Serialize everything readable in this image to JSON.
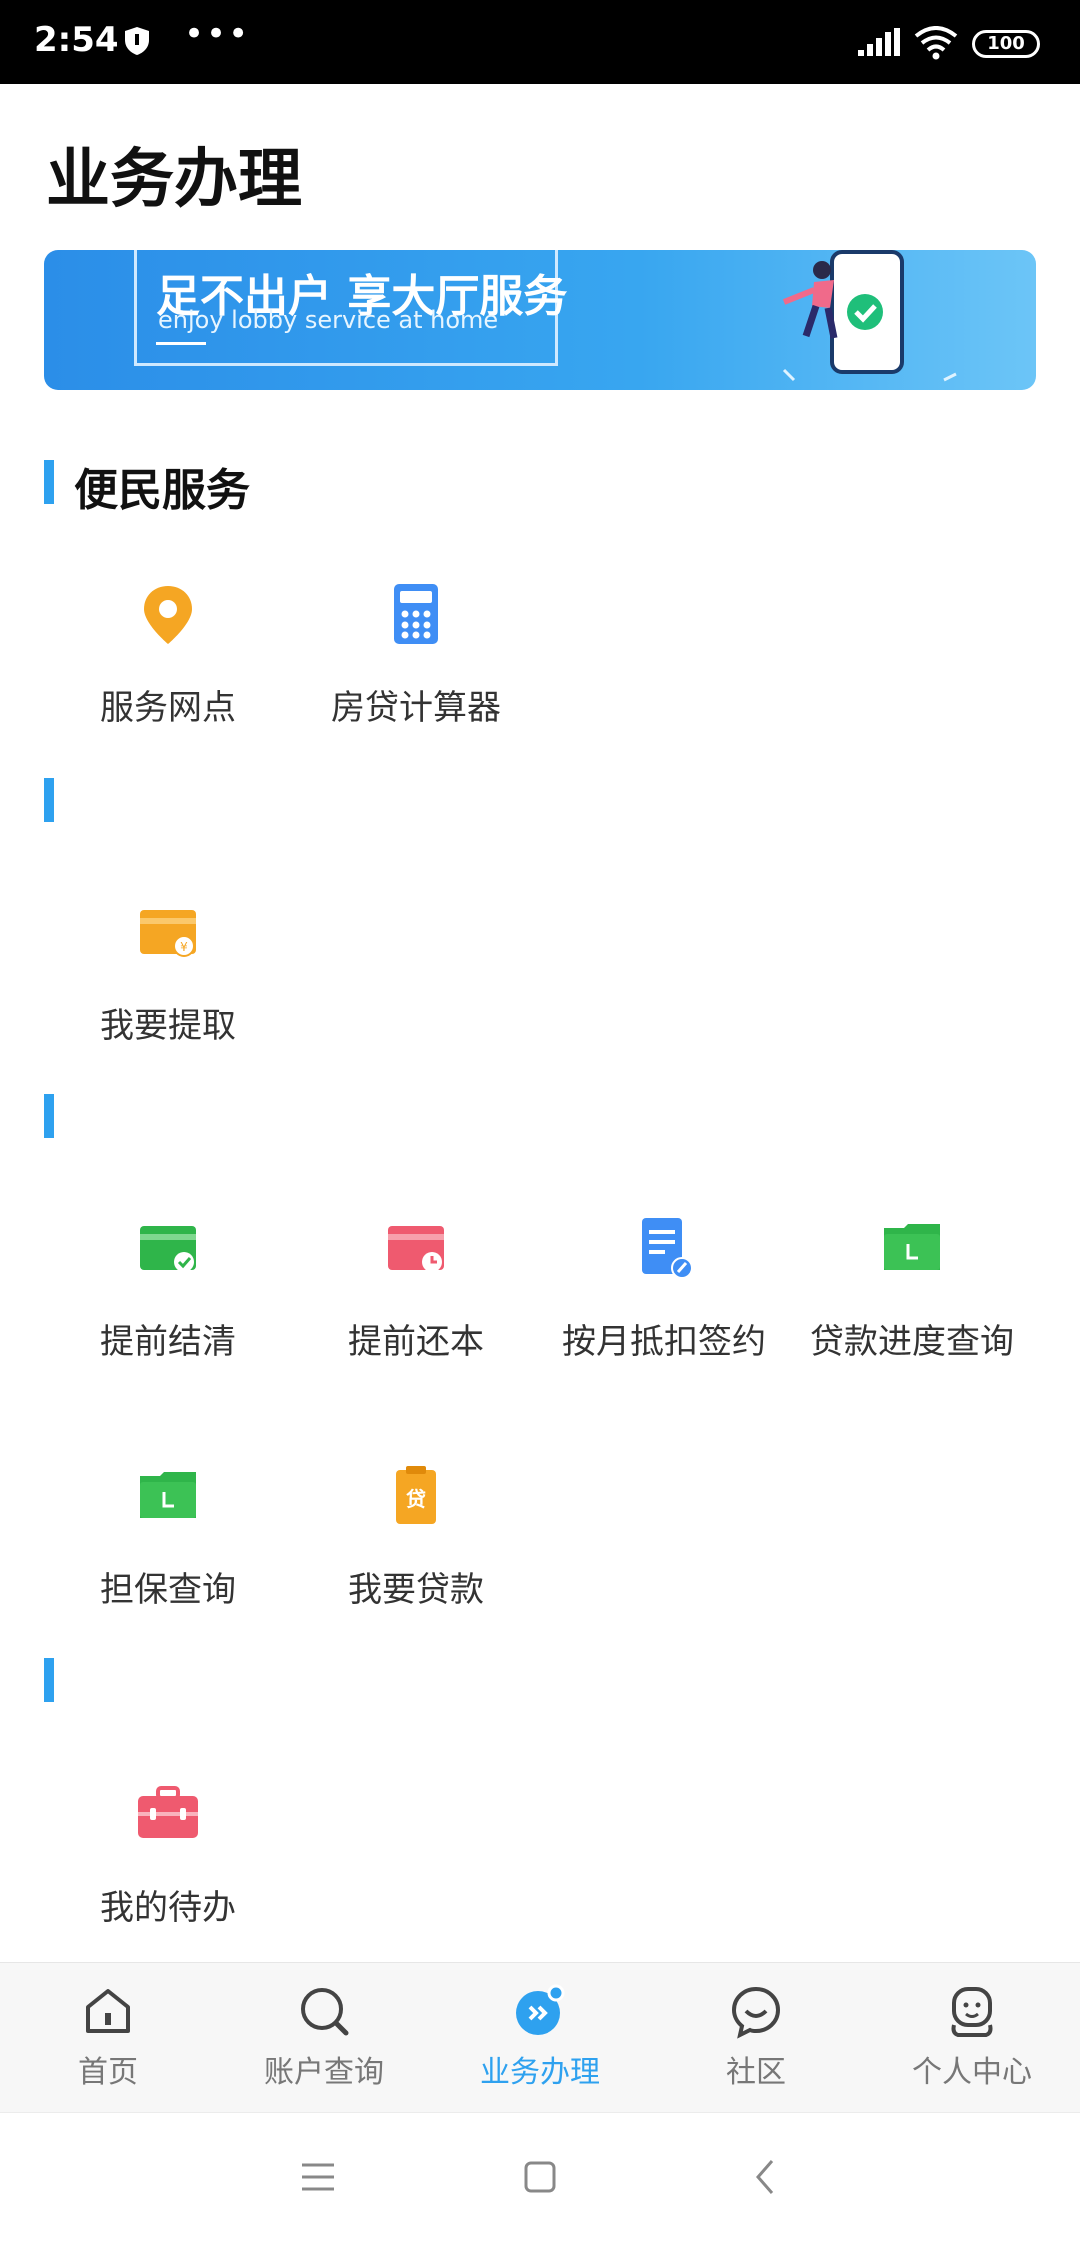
{
  "status_bar": {
    "time": "2:54",
    "battery": "100"
  },
  "page_title": "业务办理",
  "banner": {
    "title": "足不出户 享大厅服务",
    "subtitle": "enjoy lobby service at home"
  },
  "sections": [
    {
      "title": "便民服务",
      "items": [
        {
          "label": "服务网点",
          "icon": "location-pin-icon"
        },
        {
          "label": "房贷计算器",
          "icon": "calculator-icon"
        }
      ]
    },
    {
      "title": "",
      "items": [
        {
          "label": "我要提取",
          "icon": "withdraw-card-icon"
        }
      ]
    },
    {
      "title": "",
      "items": [
        {
          "label": "提前结清",
          "icon": "card-check-icon"
        },
        {
          "label": "提前还本",
          "icon": "card-clock-icon"
        },
        {
          "label": "按月抵扣签约",
          "icon": "document-sign-icon"
        },
        {
          "label": "贷款进度查询",
          "icon": "folder-progress-icon"
        },
        {
          "label": "担保查询",
          "icon": "folder-guarantee-icon"
        },
        {
          "label": "我要贷款",
          "icon": "loan-clipboard-icon"
        }
      ]
    },
    {
      "title": "",
      "items": [
        {
          "label": "我的待办",
          "icon": "toolbox-icon"
        }
      ]
    }
  ],
  "bottom_nav": [
    {
      "label": "首页",
      "icon": "home-icon",
      "active": false
    },
    {
      "label": "账户查询",
      "icon": "search-icon",
      "active": false
    },
    {
      "label": "业务办理",
      "icon": "business-icon",
      "active": true
    },
    {
      "label": "社区",
      "icon": "chat-icon",
      "active": false
    },
    {
      "label": "个人中心",
      "icon": "user-icon",
      "active": false
    }
  ],
  "colors": {
    "accent": "#2ea1ef",
    "banner": "#38a6f0"
  }
}
